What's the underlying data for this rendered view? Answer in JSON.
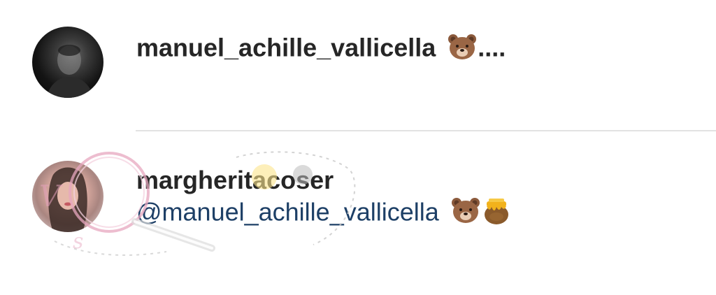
{
  "comments": [
    {
      "username": "manuel_achille_vallicella",
      "emoji": "bear-face-emoji",
      "trailing_text": "...."
    },
    {
      "username": "margheritacoser",
      "mention": "@manuel_achille_vallicella",
      "emojis": [
        "bear-face-emoji",
        "honey-pot-emoji"
      ]
    }
  ],
  "colors": {
    "username": "#262626",
    "mention": "#1d3f66",
    "divider": "#e2e2e2",
    "background": "#ffffff"
  }
}
